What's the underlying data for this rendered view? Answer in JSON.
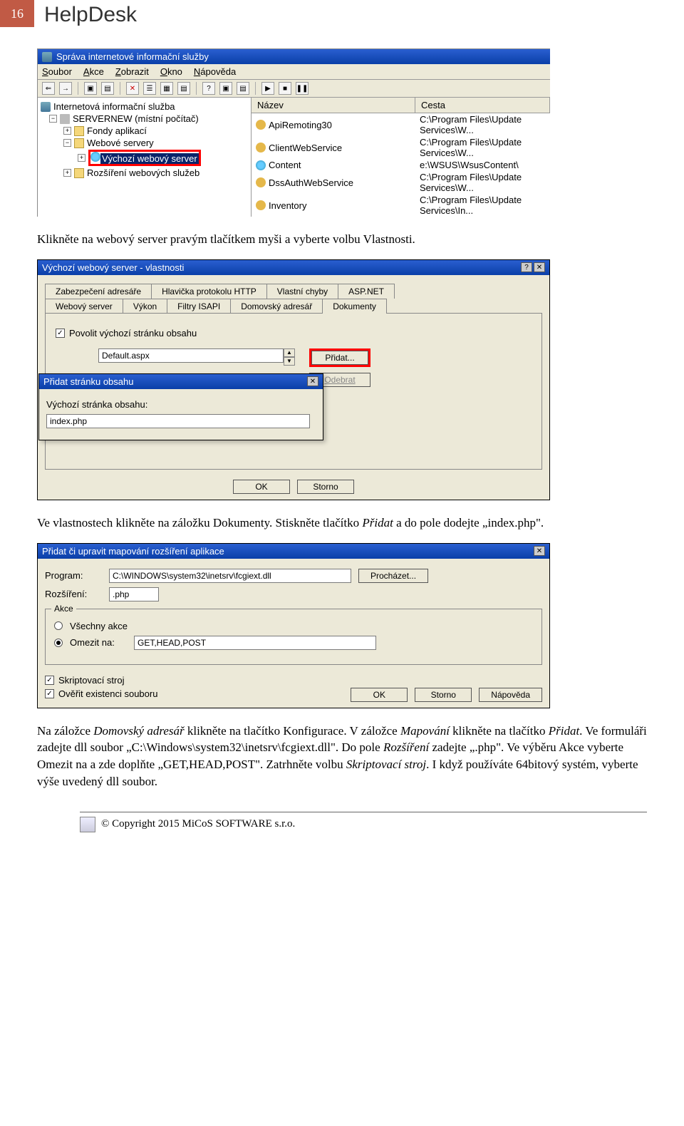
{
  "header": {
    "page_number": "16",
    "title": "HelpDesk"
  },
  "text": {
    "p1": "Klikněte na webový server pravým tlačítkem myši a vyberte volbu Vlastnosti.",
    "p2a": "Ve vlastnostech klikněte na záložku Dokumenty. Stiskněte tlačítko ",
    "p2_i1": "Přidat",
    "p2b": " a do pole dodejte „index.php\".",
    "p3a": "Na záložce ",
    "p3_i1": "Domovský adresář",
    "p3b": " klikněte na tlačítko Konfigurace. V záložce ",
    "p3_i2": "Mapování",
    "p3c": " klikněte na tlačítko ",
    "p3_i3": "Přidat",
    "p3d": ". Ve formuláři zadejte dll soubor „C:\\Windows\\system32\\inetsrv\\fcgiext.dll\". Do pole ",
    "p3_i4": "Rozšíření",
    "p3e": " zadejte „.php\". Ve výběru Akce vyberte Omezit na a zde doplňte „GET,HEAD,POST\". Zatrhněte volbu ",
    "p3_i5": "Skriptovací stroj",
    "p3f": ". I když používáte 64bitový systém, vyberte výše uvedený dll soubor."
  },
  "ss1": {
    "title": "Správa internetové informační služby",
    "menu": [
      "Soubor",
      "Akce",
      "Zobrazit",
      "Okno",
      "Nápověda"
    ],
    "tree": {
      "root": "Internetová informační služba",
      "server": "SERVERNEW (místní počítač)",
      "pools": "Fondy aplikací",
      "webservers": "Webové servery",
      "selected": "Výchozí webový server",
      "ext": "Rozšíření webových služeb"
    },
    "list": {
      "hdr_name": "Název",
      "hdr_path": "Cesta",
      "rows": [
        {
          "name": "ApiRemoting30",
          "path": "C:\\Program Files\\Update Services\\W..."
        },
        {
          "name": "ClientWebService",
          "path": "C:\\Program Files\\Update Services\\W..."
        },
        {
          "name": "Content",
          "path": "e:\\WSUS\\WsusContent\\"
        },
        {
          "name": "DssAuthWebService",
          "path": "C:\\Program Files\\Update Services\\W..."
        },
        {
          "name": "Inventory",
          "path": "C:\\Program Files\\Update Services\\In..."
        }
      ]
    }
  },
  "ss2": {
    "title": "Výchozí webový server - vlastnosti",
    "tabs_row1": [
      "Zabezpečení adresáře",
      "Hlavička protokolu HTTP",
      "Vlastní chyby",
      "ASP.NET"
    ],
    "tabs_row2": [
      "Webový server",
      "Výkon",
      "Filtry ISAPI",
      "Domovský adresář",
      "Dokumenty"
    ],
    "chk_enable": "Povolit výchozí stránku obsahu",
    "default_page": "Default.aspx",
    "btn_add": "Přidat...",
    "btn_remove": "Odebrat",
    "btn_ok": "OK",
    "btn_cancel": "Storno",
    "inner": {
      "title": "Přidat stránku obsahu",
      "label": "Výchozí stránka obsahu:",
      "value": "index.php"
    }
  },
  "ss3": {
    "title": "Přidat či upravit mapování rozšíření aplikace",
    "lbl_program": "Program:",
    "val_program": "C:\\WINDOWS\\system32\\inetsrv\\fcgiext.dll",
    "btn_browse": "Procházet...",
    "lbl_ext": "Rozšíření:",
    "val_ext": ".php",
    "legend_action": "Akce",
    "radio_all": "Všechny akce",
    "radio_limit": "Omezit na:",
    "val_limit": "GET,HEAD,POST",
    "chk_script": "Skriptovací stroj",
    "chk_verify": "Ověřit existenci souboru",
    "btn_ok": "OK",
    "btn_cancel": "Storno",
    "btn_help": "Nápověda"
  },
  "footer": "© Copyright 2015 MiCoS SOFTWARE s.r.o."
}
